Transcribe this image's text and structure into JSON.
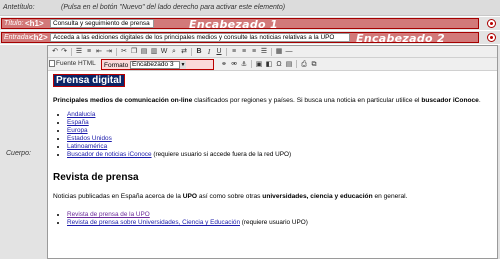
{
  "antetitulo": {
    "label": "Antetítulo:",
    "hint": "(Pulsa en el botón \"Nuevo\" del lado derecho para activar este elemento)"
  },
  "titulo": {
    "label": "Título:",
    "tag": "<h1>",
    "value": "Consulta y seguimiento de prensa",
    "annotation": "Encabezado 1"
  },
  "entrada": {
    "label": "Entrada:",
    "tag": "<h2>",
    "value": "Acceda a las ediciones digitales de los principales medios y consulte las noticias relativas a la UPO",
    "annotation": "Encabezado 2"
  },
  "cuerpo": {
    "label": "Cuerpo:"
  },
  "toolbar": {
    "source_label": "Fuente HTML",
    "format_label": "Formato",
    "format_value": "Encabezado 3"
  },
  "document": {
    "h1": "Prensa digital",
    "p1_lead": "Principales medios de comunicación on-line",
    "p1_mid": " clasificados por regiones y países. Si busca una noticia en particular utilice el ",
    "p1_bold": "buscador iConoce",
    "p1_end": ".",
    "links1": [
      "Andalucía",
      "España",
      "Europa",
      "Estados Unidos",
      "Latinoamérica",
      "Buscador de noticias iConoce"
    ],
    "links1_suffix": " (requiere usuario si accede fuera de la red UPO)",
    "h2": "Revista de prensa",
    "p2_a": "Noticias publicadas en España acerca de la ",
    "p2_b": "UPO",
    "p2_c": " así como sobre otras ",
    "p2_d": "universidades, ciencia y educación",
    "p2_e": " en general.",
    "links2": [
      "Revista de prensa de la UPO",
      "Revista de prensa sobre Universidades, Ciencia y Educación"
    ],
    "links2_suffix": " (requiere usuario UPO)"
  },
  "colors": {
    "highlight": "#d27979",
    "highlight_border": "#a50000",
    "h1_bg": "#0b2466",
    "link": "#1a1aaa",
    "visited_link": "#6b2a9a"
  }
}
